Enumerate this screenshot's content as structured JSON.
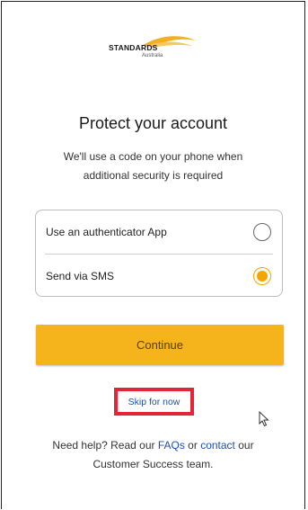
{
  "logo": {
    "brand": "STANDARDS",
    "sub": "Australia"
  },
  "heading": {
    "title": "Protect your account"
  },
  "subtitle": {
    "line1": "We'll use a code on your phone when",
    "line2": "additional security is required"
  },
  "options": [
    {
      "label": "Use an authenticator App",
      "selected": false
    },
    {
      "label": "Send via SMS",
      "selected": true
    }
  ],
  "continue_label": "Continue",
  "skip_label": "Skip for now",
  "help": {
    "prefix": "Need help? Read our ",
    "faqs": "FAQs",
    "or": " or ",
    "contact": "contact",
    "suffix": " our",
    "line2": "Customer Success team."
  },
  "colors": {
    "accent": "#f5b31c",
    "radio_selected": "#f5a500",
    "link": "#1f4fb0",
    "highlight": "#e32636"
  }
}
